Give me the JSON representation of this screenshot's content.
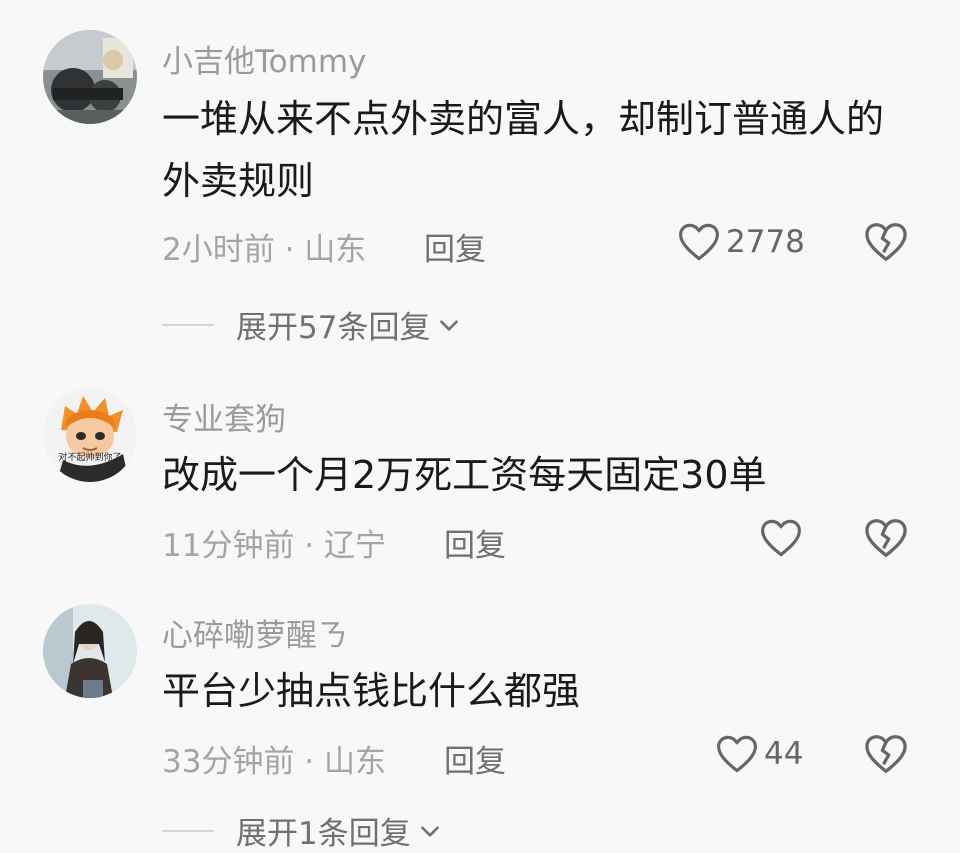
{
  "comments": [
    {
      "username": "小吉他Tommy",
      "text": "一堆从来不点外卖的富人，却制订普通人的外卖规则",
      "meta": "2小时前 · 山东",
      "reply_label": "回复",
      "likes": "2778",
      "expand_label": "展开57条回复"
    },
    {
      "username": "专业套狗",
      "text": "改成一个月2万死工资每天固定30单",
      "meta": "11分钟前 · 辽宁",
      "reply_label": "回复",
      "likes": "",
      "avatar_caption": "对不起帅到你了"
    },
    {
      "username": "心碎嘞萝醒ㄋ",
      "text": "平台少抽点钱比什么都强",
      "meta": "33分钟前 · 山东",
      "reply_label": "回复",
      "likes": "44",
      "expand_label": "展开1条回复"
    }
  ],
  "icons": {
    "like": "heart-outline-icon",
    "dislike": "broken-heart-icon",
    "expand": "chevron-down-icon"
  },
  "colors": {
    "background": "#f8f8f8",
    "text": "#1a1a1a",
    "muted": "#a4a4a4"
  }
}
